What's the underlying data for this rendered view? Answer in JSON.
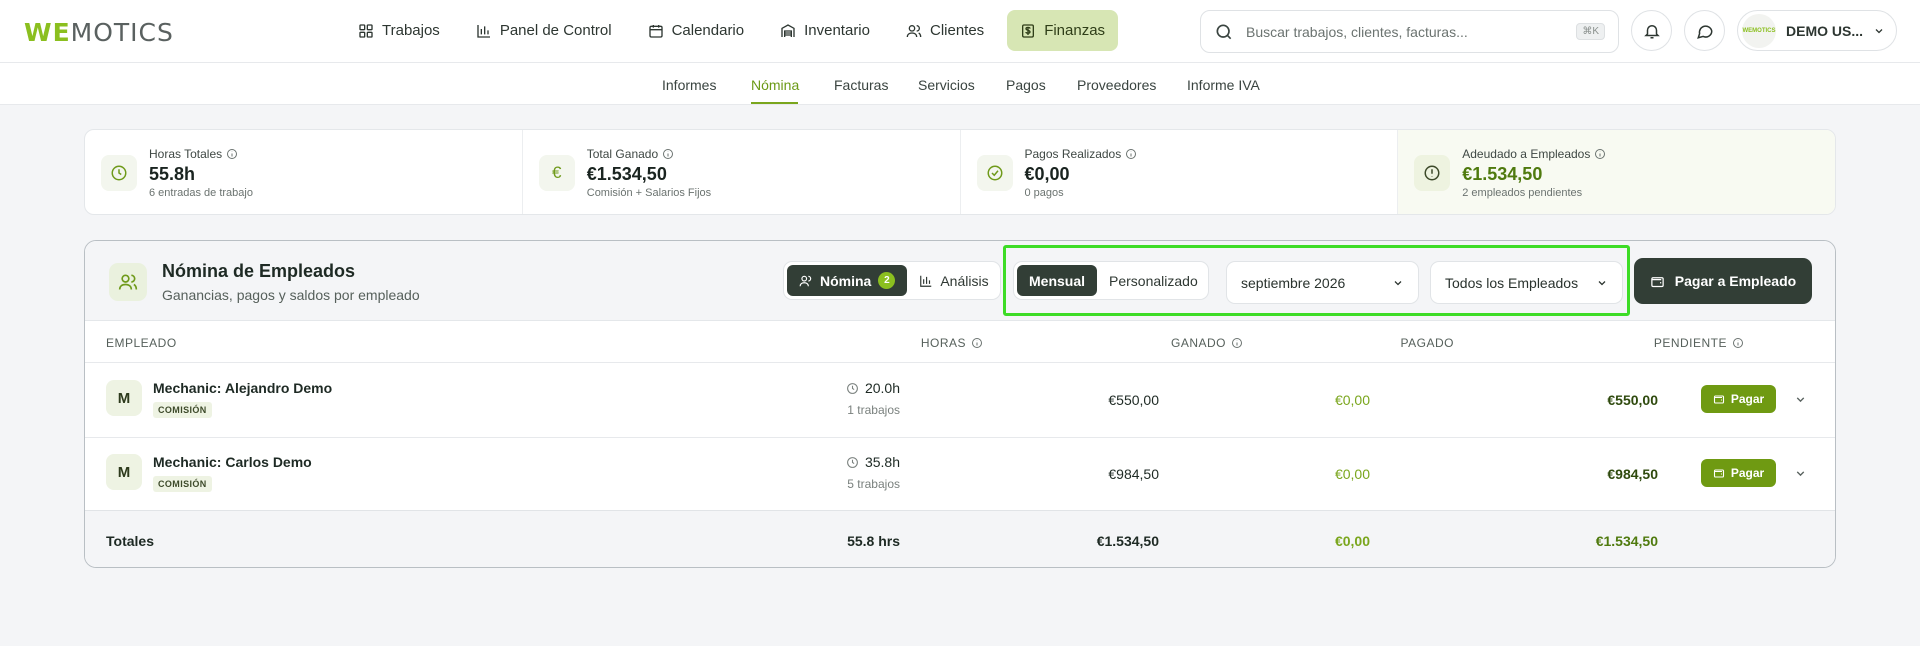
{
  "app": {
    "logo_we": "WE",
    "logo_rest": "MOTICS",
    "avatar_text": "WEMOTICS"
  },
  "nav": [
    {
      "label": "Trabajos",
      "icon": "grid-icon"
    },
    {
      "label": "Panel de Control",
      "icon": "bar-chart-icon"
    },
    {
      "label": "Calendario",
      "icon": "calendar-icon"
    },
    {
      "label": "Inventario",
      "icon": "warehouse-icon"
    },
    {
      "label": "Clientes",
      "icon": "users-icon"
    },
    {
      "label": "Finanzas",
      "icon": "dollar-icon",
      "active": true
    }
  ],
  "search": {
    "placeholder": "Buscar trabajos, clientes, facturas...",
    "shortcut": "⌘K"
  },
  "user": {
    "name": "DEMO US..."
  },
  "subnav": [
    "Informes",
    "Nómina",
    "Facturas",
    "Servicios",
    "Pagos",
    "Proveedores",
    "Informe IVA"
  ],
  "subnav_active": "Nómina",
  "stats": [
    {
      "label": "Horas Totales",
      "value": "55.8h",
      "sub": "6 entradas de trabajo",
      "icon": "clock-icon"
    },
    {
      "label": "Total Ganado",
      "value": "€1.534,50",
      "sub": "Comisión + Salarios Fijos",
      "icon": "euro-icon"
    },
    {
      "label": "Pagos Realizados",
      "value": "€0,00",
      "sub": "0 pagos",
      "icon": "check-circle-icon"
    },
    {
      "label": "Adeudado a Empleados",
      "value": "€1.534,50",
      "sub": "2 empleados pendientes",
      "icon": "alert-circle-icon"
    }
  ],
  "payroll": {
    "title": "Nómina de Empleados",
    "subtitle": "Ganancias, pagos y saldos por empleado",
    "view_tabs": {
      "nomina": "Nómina",
      "nomina_count": "2",
      "analisis": "Análisis"
    },
    "period_tabs": {
      "mensual": "Mensual",
      "personalizado": "Personalizado"
    },
    "month": "septiembre 2026",
    "employee_filter": "Todos los Empleados",
    "pay_button": "Pagar a Empleado",
    "columns": {
      "employee": "EMPLEADO",
      "hours": "HORAS",
      "earned": "GANADO",
      "paid": "PAGADO",
      "pending": "PENDIENTE"
    },
    "rows": [
      {
        "initial": "M",
        "name": "Mechanic: Alejandro Demo",
        "tag": "COMISIÓN",
        "hours": "20.0h",
        "jobs": "1 trabajos",
        "earned": "€550,00",
        "paid": "€0,00",
        "pending": "€550,00",
        "action": "Pagar"
      },
      {
        "initial": "M",
        "name": "Mechanic: Carlos Demo",
        "tag": "COMISIÓN",
        "hours": "35.8h",
        "jobs": "5 trabajos",
        "earned": "€984,50",
        "paid": "€0,00",
        "pending": "€984,50",
        "action": "Pagar"
      }
    ],
    "totals": {
      "label": "Totales",
      "hours": "55.8 hrs",
      "earned": "€1.534,50",
      "paid": "€0,00",
      "pending": "€1.534,50"
    }
  },
  "colors": {
    "accent": "#8bbf1f",
    "dark": "#323e36",
    "highlight": "#3ddc26"
  }
}
